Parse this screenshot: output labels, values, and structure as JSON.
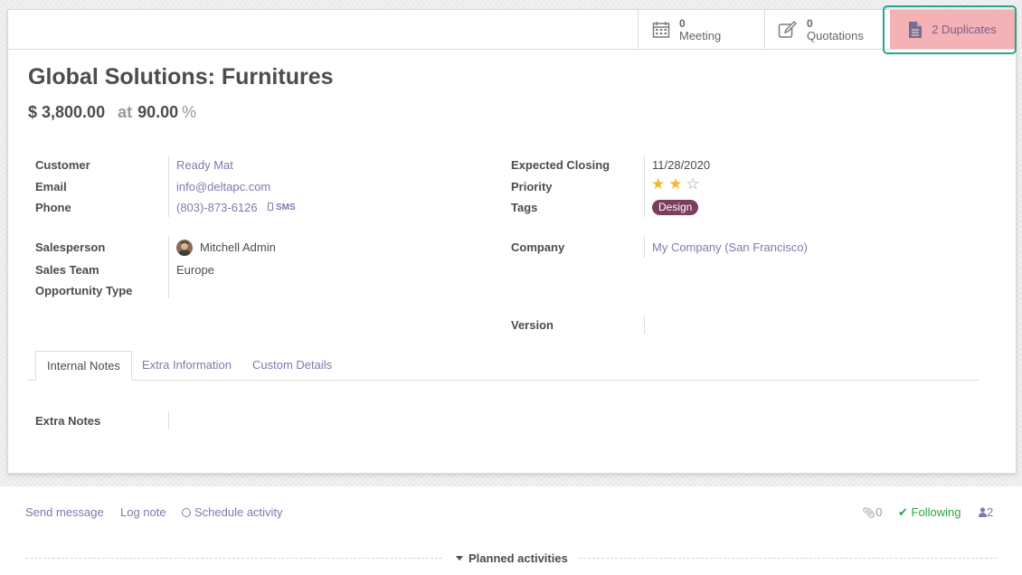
{
  "stat_buttons": {
    "meeting": {
      "count": "0",
      "label": "Meeting"
    },
    "quotations": {
      "count": "0",
      "label": "Quotations"
    },
    "duplicates": {
      "label": "2 Duplicates"
    }
  },
  "record": {
    "title": "Global Solutions: Furnitures",
    "amount": "$ 3,800.00",
    "at_label": "at",
    "probability": "90.00",
    "percent_sign": "%"
  },
  "fields_left": {
    "customer": {
      "label": "Customer",
      "value": "Ready Mat"
    },
    "email": {
      "label": "Email",
      "value": "info@deltapc.com"
    },
    "phone": {
      "label": "Phone",
      "value": "(803)-873-6126",
      "sms": "SMS"
    },
    "salesperson": {
      "label": "Salesperson",
      "value": "Mitchell Admin"
    },
    "sales_team": {
      "label": "Sales Team",
      "value": "Europe"
    },
    "opportunity_type": {
      "label": "Opportunity Type",
      "value": ""
    }
  },
  "fields_right": {
    "expected_closing": {
      "label": "Expected Closing",
      "value": "11/28/2020"
    },
    "priority": {
      "label": "Priority",
      "stars_filled": 2,
      "stars_total": 3
    },
    "tags": {
      "label": "Tags",
      "value": "Design"
    },
    "company": {
      "label": "Company",
      "value": "My Company (San Francisco)"
    },
    "version": {
      "label": "Version",
      "value": ""
    }
  },
  "tabs": [
    "Internal Notes",
    "Extra Information",
    "Custom Details"
  ],
  "notes": {
    "label": "Extra Notes"
  },
  "chatter": {
    "send_message": "Send message",
    "log_note": "Log note",
    "schedule_activity": "Schedule activity",
    "attachments": "0",
    "following": "Following",
    "followers": "2",
    "planned_activities": "Planned activities"
  },
  "colors": {
    "link": "#7c7bad",
    "tag_bg": "#7b3f5d",
    "star": "#f3b731",
    "following": "#28a745",
    "duplicates_bg": "#f4b2b6",
    "highlight_border": "#27a58a"
  }
}
